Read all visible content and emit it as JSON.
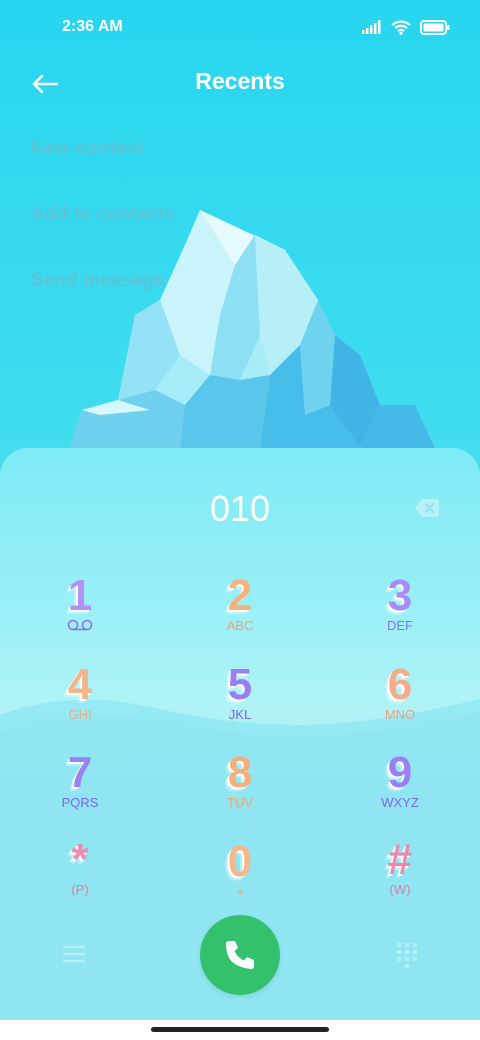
{
  "status_bar": {
    "time": "2:36 AM",
    "icons": [
      "signal-icon",
      "wifi-icon",
      "battery-icon"
    ]
  },
  "header": {
    "title": "Recents",
    "back_icon": "back-arrow-icon"
  },
  "menu": {
    "items": [
      {
        "label": "New contact"
      },
      {
        "label": "Add to contacts"
      },
      {
        "label": "Send message"
      }
    ]
  },
  "dialer": {
    "number": "010",
    "backspace_icon": "backspace-icon",
    "keys": [
      {
        "digit": "1",
        "letters": "",
        "digit_color": "#b392f6",
        "letters_color": "#8c73f0",
        "sub_icon": "voicemail-icon"
      },
      {
        "digit": "2",
        "letters": "ABC",
        "digit_color": "#f5b27c",
        "letters_color": "#e9a778"
      },
      {
        "digit": "3",
        "letters": "DEF",
        "digit_color": "#a98bf5",
        "letters_color": "#8870ef"
      },
      {
        "digit": "4",
        "letters": "GHI",
        "digit_color": "#f6b48a",
        "letters_color": "#efa984"
      },
      {
        "digit": "5",
        "letters": "JKL",
        "digit_color": "#9b7ef4",
        "letters_color": "#7a63ea"
      },
      {
        "digit": "6",
        "letters": "MNO",
        "digit_color": "#f5ad88",
        "letters_color": "#ef9f82"
      },
      {
        "digit": "7",
        "letters": "PQRS",
        "digit_color": "#9a82f5",
        "letters_color": "#7e67ec"
      },
      {
        "digit": "8",
        "letters": "TUV",
        "digit_color": "#f3b07c",
        "letters_color": "#e9a56e"
      },
      {
        "digit": "9",
        "letters": "WXYZ",
        "digit_color": "#9a7ff4",
        "letters_color": "#7e66ea"
      },
      {
        "digit": "*",
        "letters": "(P)",
        "digit_color": "#f08bb1",
        "letters_color": "#e27aa3"
      },
      {
        "digit": "0",
        "letters": "+",
        "digit_color": "#f4b88a",
        "letters_color": "#eaa679"
      },
      {
        "digit": "#",
        "letters": "(W)",
        "digit_color": "#ef88b0",
        "letters_color": "#e27aa3"
      }
    ]
  },
  "bottom_bar": {
    "menu_icon": "hamburger-menu-icon",
    "call_icon": "phone-icon",
    "call_color": "#34c16e",
    "keypad_icon": "dialpad-icon"
  },
  "colors": {
    "background_top": "#27d6ef",
    "menu_text": "#5cc4d6"
  }
}
